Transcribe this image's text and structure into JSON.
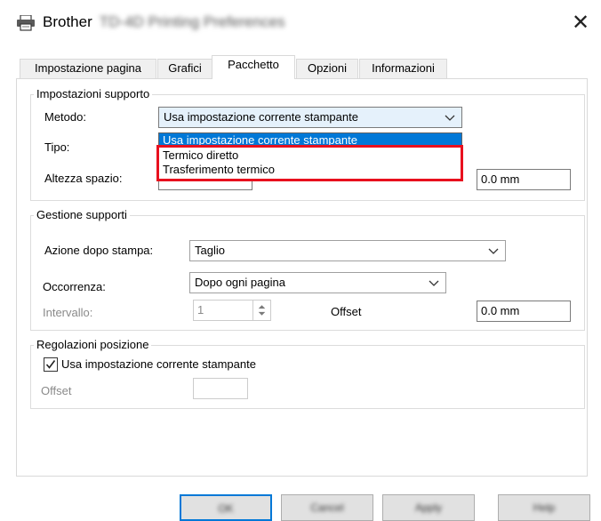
{
  "window": {
    "title": "Brother",
    "title_model": "TD-4D Printing Preferences",
    "close_glyph": "✕",
    "printer_icon": "printer-icon"
  },
  "tabs": [
    {
      "label": "Impostazione pagina",
      "active": false
    },
    {
      "label": "Grafici",
      "active": false
    },
    {
      "label": "Pacchetto",
      "active": true
    },
    {
      "label": "Opzioni",
      "active": false
    },
    {
      "label": "Informazioni",
      "active": false
    }
  ],
  "media_settings": {
    "group_title": "Impostazioni supporto",
    "method_label": "Metodo:",
    "method_value": "Usa impostazione corrente stampante",
    "type_label": "Tipo:",
    "gap_height_label": "Altezza spazio:",
    "gap_right_value": "0.0 mm",
    "method_options": [
      "Usa impostazione corrente stampante",
      "Termico diretto",
      "Trasferimento termico"
    ]
  },
  "media_management": {
    "group_title": "Gestione supporti",
    "after_print_label": "Azione dopo stampa:",
    "after_print_value": "Taglio",
    "occurrence_label": "Occorrenza:",
    "occurrence_value": "Dopo ogni pagina",
    "interval_label": "Intervallo:",
    "interval_value": "1",
    "offset_label": "Offset",
    "offset_value": "0.0 mm"
  },
  "position_adjust": {
    "group_title": "Regolazioni posizione",
    "checkbox_label": "Usa impostazione corrente stampante",
    "checked": true,
    "offset_label": "Offset",
    "offset_value": ""
  },
  "buttons": {
    "ok": "OK",
    "cancel": "Cancel",
    "apply": "Apply",
    "help": "Help"
  },
  "colors": {
    "accent": "#0078d7",
    "highlight_border": "#e8101e"
  }
}
